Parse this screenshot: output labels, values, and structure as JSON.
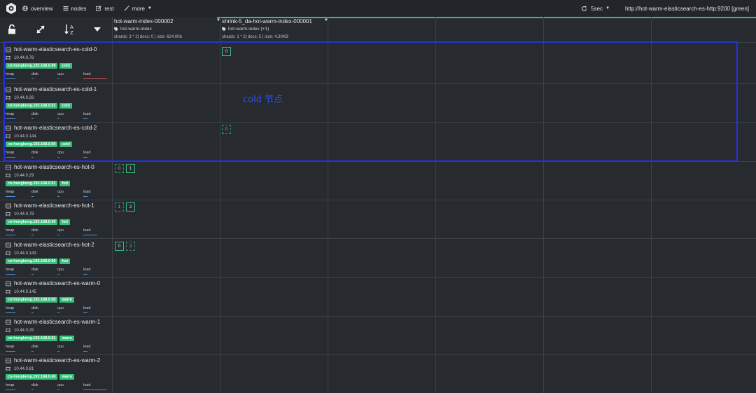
{
  "nav": {
    "items": [
      {
        "label": "overview",
        "icon": "globe-icon"
      },
      {
        "label": "nodes",
        "icon": "list-icon"
      },
      {
        "label": "rest",
        "icon": "edit-icon"
      },
      {
        "label": "more",
        "icon": "magic-wand-icon"
      }
    ],
    "refresh": "5sec",
    "cluster_url": "http://hot-warm-elasticsearch-es-http:9200 [green]"
  },
  "indices": [
    {
      "name": "hot-warm-index-000002",
      "alias": "hot-warm-index",
      "stats": "shards: 3 * 2| docs: 0 | size: 624.00b"
    },
    {
      "name": "shrink-5_da-hot-warm-index-000001",
      "alias": "hot-warm-index (+1)",
      "stats": "shards: 1 * 2| docs: 5 | size: 4.30KB"
    }
  ],
  "metric_labels": [
    "heap",
    "disk",
    "cpu",
    "load"
  ],
  "nodes": [
    {
      "name": "hot-warm-elasticsearch-es-cold-0",
      "ip": "10.44.0.78",
      "zone": "cn-hongkong.192.168.0.49",
      "role": "cold"
    },
    {
      "name": "hot-warm-elasticsearch-es-cold-1",
      "ip": "10.44.0.26",
      "zone": "cn-hongkong.192.168.0.51",
      "role": "cold"
    },
    {
      "name": "hot-warm-elasticsearch-es-cold-2",
      "ip": "10.44.0.144",
      "zone": "cn-hongkong.192.168.0.50",
      "role": "cold"
    },
    {
      "name": "hot-warm-elasticsearch-es-hot-0",
      "ip": "10.44.0.29",
      "zone": "cn-hongkong.192.168.0.51",
      "role": "hot"
    },
    {
      "name": "hot-warm-elasticsearch-es-hot-1",
      "ip": "10.44.0.79",
      "zone": "cn-hongkong.192.168.0.49",
      "role": "hot"
    },
    {
      "name": "hot-warm-elasticsearch-es-hot-2",
      "ip": "10.44.0.143",
      "zone": "cn-hongkong.192.168.0.50",
      "role": "hot"
    },
    {
      "name": "hot-warm-elasticsearch-es-warm-0",
      "ip": "10.44.0.145",
      "zone": "cn-hongkong.192.168.0.50",
      "role": "warm"
    },
    {
      "name": "hot-warm-elasticsearch-es-warm-1",
      "ip": "10.44.0.25",
      "zone": "cn-hongkong.192.168.0.51",
      "role": "warm"
    },
    {
      "name": "hot-warm-elasticsearch-es-warm-2",
      "ip": "10.44.0.81",
      "zone": "cn-hongkong.192.168.0.49",
      "role": "warm"
    }
  ],
  "shards": {
    "s_cold0_b": "0",
    "s_cold2_b": "0",
    "s_hot0_r": "0",
    "s_hot0_p": "1",
    "s_hot1_r": "1",
    "s_hot1_p": "2",
    "s_hot2_p": "0",
    "s_hot2_r": "2"
  },
  "annotation": {
    "label": "cold 节点"
  },
  "colors": {
    "accent": "#36c07a",
    "background": "#272b30",
    "annotation": "#2233dd",
    "load_high": "#d9534f"
  }
}
